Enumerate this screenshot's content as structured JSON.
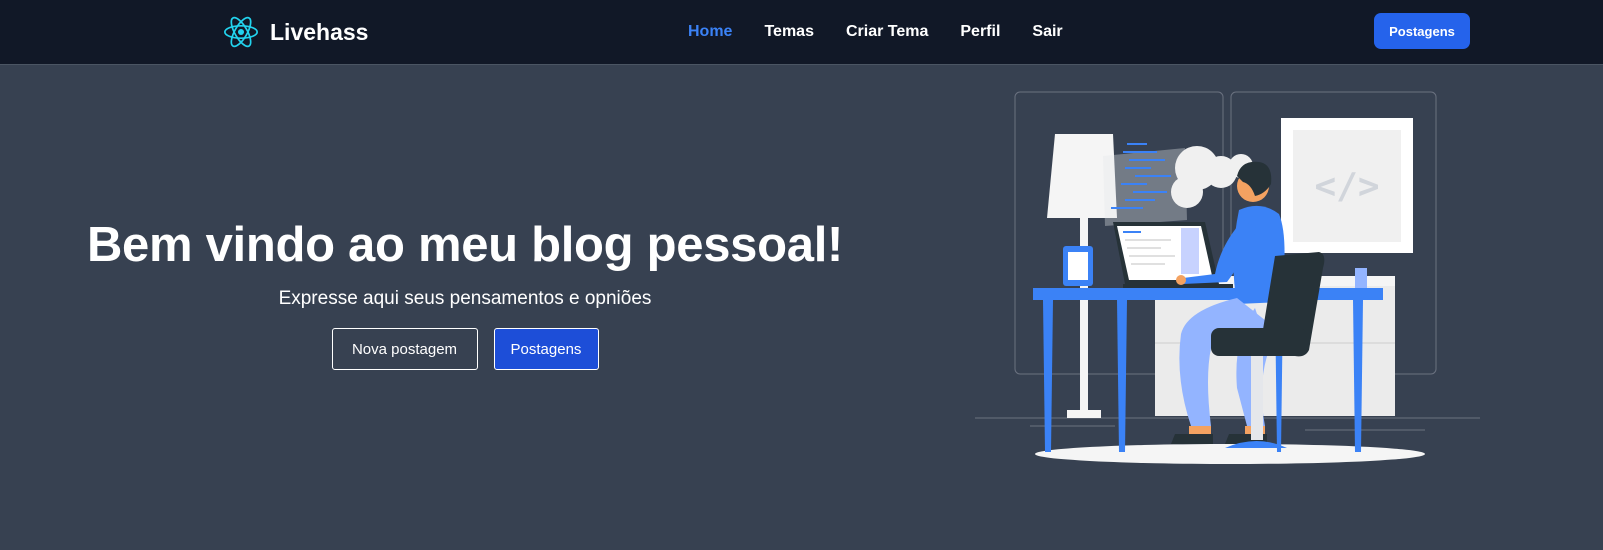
{
  "brand": {
    "name": "Livehass",
    "icon": "react-atom-icon",
    "icon_color": "#22d3ee"
  },
  "nav": {
    "items": [
      {
        "label": "Home",
        "active": true
      },
      {
        "label": "Temas",
        "active": false
      },
      {
        "label": "Criar Tema",
        "active": false
      },
      {
        "label": "Perfil",
        "active": false
      },
      {
        "label": "Sair",
        "active": false
      }
    ],
    "cta_label": "Postagens"
  },
  "hero": {
    "title": "Bem vindo ao meu blog pessoal!",
    "subtitle": "Expresse aqui seus pensamentos e opniões",
    "primary_action": "Nova postagem",
    "secondary_action": "Postagens",
    "illustration": {
      "name": "developer-at-desk-illustration",
      "board_text": "</>"
    }
  },
  "colors": {
    "navbar_bg": "#111827",
    "page_bg": "#374151",
    "accent": "#2563eb",
    "active_link": "#3b82f6",
    "illustration_blue": "#3b82f6",
    "illustration_dark": "#263238"
  }
}
